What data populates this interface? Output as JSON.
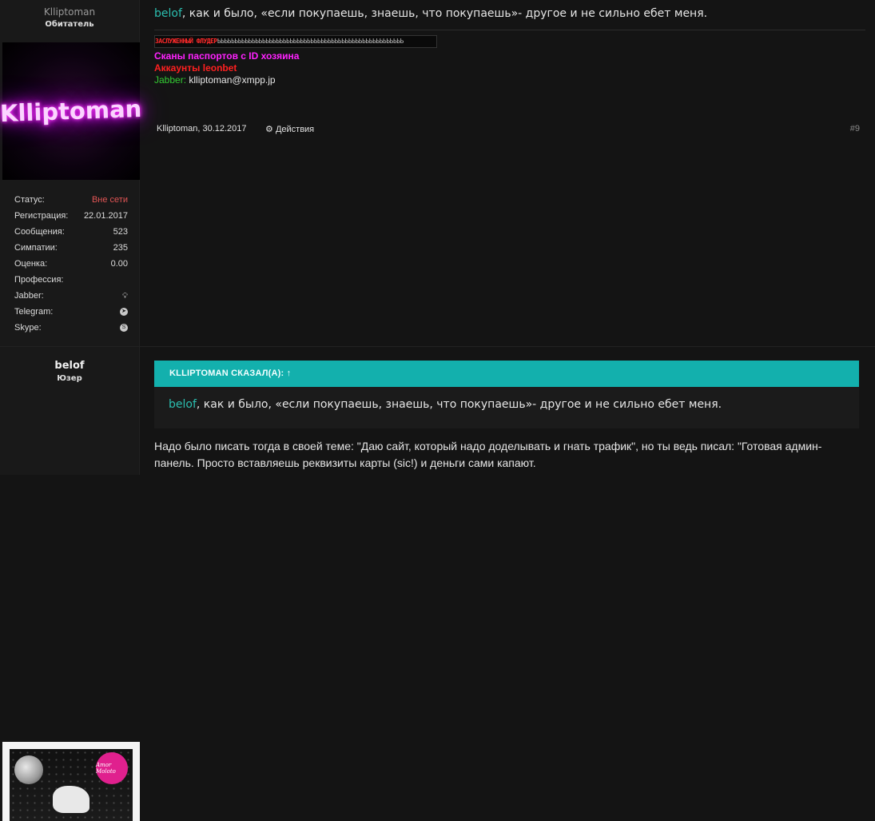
{
  "post1": {
    "user": {
      "name": "Klliptoman",
      "title": "Обитатель",
      "avatar_text": "Klliptoman"
    },
    "stats": [
      {
        "label": "Статус:",
        "value": "Вне сети"
      },
      {
        "label": "Регистрация:",
        "value": "22.01.2017"
      },
      {
        "label": "Сообщения:",
        "value": "523"
      },
      {
        "label": "Симпатии:",
        "value": "235"
      },
      {
        "label": "Оценка:",
        "value": "0.00"
      },
      {
        "label": "Профессия:",
        "value": ""
      },
      {
        "label": "Jabber:",
        "icon": "lightbulb-icon"
      },
      {
        "label": "Telegram:",
        "icon": "telegram-icon"
      },
      {
        "label": "Skype:",
        "icon": "skype-icon"
      }
    ],
    "message": {
      "mention": "belof",
      "text": ", как и было, «если покупаешь, знаешь, что покупаешь»- другое и не сильно ебет меня."
    },
    "signature": {
      "banner_red": "ЗАСЛУЖЕННЫЙ ФЛУДЕР",
      "banner_rest": "ЬЬЬЬЬЬЬЬЬЬЬЬЬЬЬЬЬЬЬЬЬЬЬЬЬЬЬЬЬЬЬЬЬЬЬЬЬЬЬЬЬЬЬЬЬЬЬЬЬЬЬЬЬЬ",
      "line1": "Сканы паспортов с ID хозяина",
      "line2": "Аккаунты leonbet",
      "jabber_label": "Jabber:",
      "jabber_value": "klliptoman@xmpp.jp"
    },
    "meta": {
      "author_date": "Klliptoman, 30.12.2017",
      "actions_label": "Действия",
      "post_number": "#9"
    }
  },
  "post2": {
    "user": {
      "name": "belof",
      "title": "Юзер",
      "avatar_badge": "Amor Moloto"
    },
    "quote": {
      "header": "KLLIPTOMAN СКАЗАЛ(А): ↑",
      "mention": "belof",
      "text": ", как и было, «если покупаешь, знаешь, что покупаешь»- другое и не сильно ебет меня."
    },
    "reply": "Надо было писать тогда в своей теме: \"Даю сайт, который надо доделывать и гнать трафик\", но ты ведь писал: \"Готовая админ-панель. Просто вставляешь реквизиты карты (sic!) и деньги сами капают."
  },
  "colors": {
    "background": "#141414",
    "sidebar": "#191919",
    "accent_teal": "#13b0ad",
    "mention": "#2bbfb0",
    "offline": "#e25555"
  }
}
